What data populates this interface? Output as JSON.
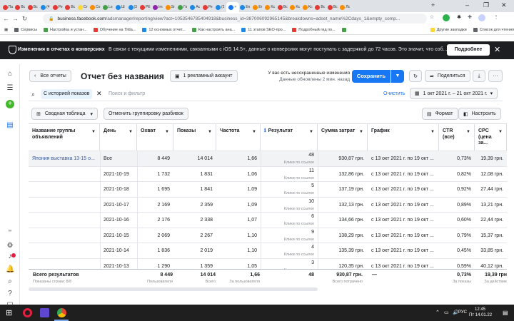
{
  "browser": {
    "tabs": [
      {
        "short": "Па",
        "color": "#e53935"
      },
      {
        "short": "Вс",
        "color": "#e53935"
      },
      {
        "short": "Вс",
        "color": "#e53935"
      },
      {
        "short": "(4",
        "color": "#1e88e5"
      },
      {
        "short": "Ре",
        "color": "#e53935"
      },
      {
        "short": "Вс",
        "color": "#e53935"
      },
      {
        "short": "Ст",
        "color": "#fdd835"
      },
      {
        "short": "Со",
        "color": "#fb8c00"
      },
      {
        "short": "Lo",
        "color": "#43a047"
      },
      {
        "short": "Ш",
        "color": "#1e88e5"
      },
      {
        "short": "(3",
        "color": "#1e88e5"
      },
      {
        "short": "РЕ",
        "color": "#e53935"
      },
      {
        "short": "Im",
        "color": "#8e24aa"
      },
      {
        "short": "Sr",
        "color": "#fb8c00"
      },
      {
        "short": "Го",
        "color": "#43a047"
      },
      {
        "short": "Ас",
        "color": "#1e88e5"
      },
      {
        "short": "Ре",
        "color": "#e53935"
      },
      {
        "short": "(2",
        "color": "#1e88e5"
      },
      {
        "short": "×",
        "color": "#1877f2"
      },
      {
        "short": "En",
        "color": "#1e88e5"
      },
      {
        "short": "Er",
        "color": "#fb8c00"
      },
      {
        "short": "Kc",
        "color": "#fb8c00"
      },
      {
        "short": "Вс",
        "color": "#e53935"
      },
      {
        "short": "Kc",
        "color": "#fb8c00"
      },
      {
        "short": "Kc",
        "color": "#fb8c00"
      },
      {
        "short": "Вс",
        "color": "#e53935"
      },
      {
        "short": "Вс",
        "color": "#e53935"
      },
      {
        "short": "Лс",
        "color": "#fb8c00"
      }
    ],
    "new_tab": "+",
    "url_domain": "business.facebook.com",
    "url_path": "/adsmanager/reporting/view?act=1053546785404918&business_id=387006092965145&breakdowns=adset_name%2Cdays_1&empty_comp..."
  },
  "bookmarks": [
    {
      "label": "Сервисы",
      "color": "#5f6368"
    },
    {
      "label": "Настройка и устан...",
      "color": "#43a047"
    },
    {
      "label": "Обучение на Tilda...",
      "color": "#e53935"
    },
    {
      "label": "12 основных отчет...",
      "color": "#1e88e5"
    },
    {
      "label": "Как настроить ана...",
      "color": "#43a047"
    },
    {
      "label": "11 этапов SEO-про...",
      "color": "#1e88e5"
    },
    {
      "label": "Подробный гид по...",
      "color": "#e53935"
    },
    {
      "label": "",
      "color": "#43a047"
    },
    {
      "label": "Другие закладки",
      "color": "#fdd835"
    },
    {
      "label": "Список для чтения",
      "color": "#5f6368"
    }
  ],
  "banner": {
    "title": "Изменения в отчетах о конверсиях",
    "body": "В связи с текущими изменениями, связанными с iOS 14.5+, данные о конверсиях могут поступать с задержкой до 72 часов. Это значит, что соб...",
    "more": "Подробнее",
    "close": "✕"
  },
  "header": {
    "back_label": "Все отчеты",
    "title": "Отчет без названия",
    "account": "1 рекламный аккаунт",
    "unsaved": "У вас есть несохраненные изменения",
    "updated": "Данные обновлены 2 мин. назад",
    "save": "Сохранить",
    "share": "Поделиться"
  },
  "filter": {
    "chip": "С историей показов",
    "placeholder": "Поиск и фильтр",
    "clear": "Очистить",
    "date_range": "1 окт 2021 г. – 21 окт 2021 г."
  },
  "toolbar": {
    "pivot": "Сводная таблица",
    "ungroup": "Отменить группировку разбивок",
    "format": "Формат",
    "customize": "Настроить"
  },
  "table": {
    "headers": [
      "Название группы объявлений",
      "День",
      "Охват",
      "Показы",
      "Частота",
      "Результат",
      "Сумма затрат",
      "График",
      "CTR (все)",
      "CPC (цена за..."
    ],
    "group_name": "Япония выставка 13-15 о...",
    "rows": [
      {
        "day": "Все",
        "reach": "8 449",
        "impr": "14 014",
        "freq": "1,66",
        "result": "48",
        "result_sub": "Клики по ссылке",
        "spend": "930,87 грн.",
        "schedule": "с 13 окт 2021 г. по 19 окт ...",
        "ctr": "0,73%",
        "cpc": "19,39 грн."
      },
      {
        "day": "2021-10-19",
        "reach": "1 732",
        "impr": "1 831",
        "freq": "1,06",
        "result": "11",
        "result_sub": "Клики по ссылке",
        "spend": "132,86 грн.",
        "schedule": "с 13 окт 2021 г. по 19 окт ...",
        "ctr": "0,82%",
        "cpc": "12,08 грн."
      },
      {
        "day": "2021-10-18",
        "reach": "1 695",
        "impr": "1 841",
        "freq": "1,09",
        "result": "5",
        "result_sub": "Клики по ссылке",
        "spend": "137,19 грн.",
        "schedule": "с 13 окт 2021 г. по 19 окт ...",
        "ctr": "0,92%",
        "cpc": "27,44 грн."
      },
      {
        "day": "2021-10-17",
        "reach": "2 169",
        "impr": "2 359",
        "freq": "1,09",
        "result": "10",
        "result_sub": "Клики по ссылке",
        "spend": "132,13 грн.",
        "schedule": "с 13 окт 2021 г. по 19 окт ...",
        "ctr": "0,89%",
        "cpc": "13,21 грн."
      },
      {
        "day": "2021-10-16",
        "reach": "2 176",
        "impr": "2 338",
        "freq": "1,07",
        "result": "6",
        "result_sub": "Клики по ссылке",
        "spend": "134,66 грн.",
        "schedule": "с 13 окт 2021 г. по 19 окт ...",
        "ctr": "0,60%",
        "cpc": "22,44 грн."
      },
      {
        "day": "2021-10-15",
        "reach": "2 069",
        "impr": "2 267",
        "freq": "1,10",
        "result": "9",
        "result_sub": "Клики по ссылке",
        "spend": "138,29 грн.",
        "schedule": "с 13 окт 2021 г. по 19 окт ...",
        "ctr": "0,79%",
        "cpc": "15,37 грн."
      },
      {
        "day": "2021-10-14",
        "reach": "1 836",
        "impr": "2 019",
        "freq": "1,10",
        "result": "4",
        "result_sub": "Клики по ссылке",
        "spend": "135,39 грн.",
        "schedule": "с 13 окт 2021 г. по 19 окт ...",
        "ctr": "0,45%",
        "cpc": "33,85 грн."
      },
      {
        "day": "2021-10-13",
        "reach": "1 290",
        "impr": "1 359",
        "freq": "1,05",
        "result": "3",
        "result_sub": "Клики по ссылке",
        "spend": "120,35 грн.",
        "schedule": "с 13 окт 2021 г. по 19 окт ...",
        "ctr": "0,59%",
        "cpc": "40,12 грн."
      }
    ],
    "totals": {
      "label": "Всего результатов",
      "rows_label": "Показаны строки: 8/8",
      "reach": "8 449",
      "reach_sub": "Пользователи",
      "impr": "14 014",
      "impr_sub": "Всего",
      "freq": "1,66",
      "freq_sub": "За пользователя",
      "result": "48",
      "result_sub": "",
      "spend": "930,87 грн.",
      "spend_sub": "Всего потрачено",
      "schedule": "—",
      "ctr": "0,73%",
      "ctr_sub": "За показы",
      "cpc": "19,39 грн",
      "cpc_sub": "За действие"
    }
  },
  "taskbar": {
    "lang": "РУС",
    "time": "12:45",
    "date": "Пт 14.01.22"
  },
  "colors": {
    "accent": "#1877f2",
    "banner_bg": "#1c1e21",
    "link": "#385898"
  }
}
